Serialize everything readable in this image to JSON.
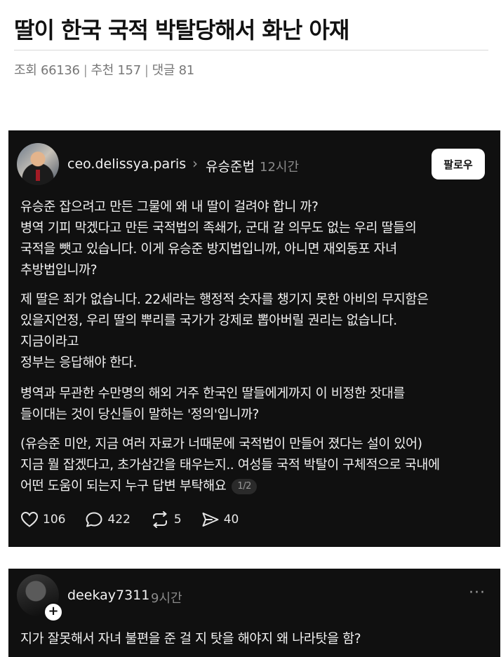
{
  "post": {
    "title": "딸이 한국 국적 박탈당해서 화난 아재",
    "views_label": "조회 66136",
    "recommend_label": "추천 157",
    "comments_label": "댓글 81",
    "separator": "|"
  },
  "thread1": {
    "username": "ceo.delissya.paris",
    "chevron": "›",
    "reply_to": "유승준법",
    "time": "12시간",
    "follow_label": "팔로우",
    "paragraphs": [
      [
        "유승준 잡으려고 만든 그물에 왜 내 딸이 걸려야 합니 까?",
        "병역 기피 막겠다고 만든 국적법의 족쇄가, 군대 갈 의무도 없는 우리 딸들의",
        "국적을 뺏고 있습니다. 이게 유승준 방지법입니까, 아니면 재외동포 자녀",
        "추방법입니까?"
      ],
      [
        "제 딸은 죄가 없습니다. 22세라는 행정적 숫자를 챙기지 못한 아비의 무지함은",
        "있을지언정, 우리 딸의 뿌리를 국가가 강제로 뽑아버릴 권리는 없습니다.",
        "지금이라고",
        "정부는 응답해야 한다."
      ],
      [
        "병역과 무관한 수만명의 해외 거주 한국인 딸들에게까지 이 비정한 잣대를",
        "들이대는 것이 당신들이 말하는 '정의'입니까?"
      ],
      [
        "(유승준 미안, 지금 여러 자료가 너때문에 국적법이 만들어 졌다는 설이 있어)",
        "지금 뭘 잡겠다고, 초가삼간을 태우는지.. 여성들 국적 박탈이 구체적으로 국내에",
        "어떤 도움이  되는지 누구 답변 부탁해요"
      ]
    ],
    "page_indicator": "1/2",
    "actions": {
      "likes": "106",
      "comments": "422",
      "reposts": "5",
      "shares": "40"
    }
  },
  "thread2": {
    "username": "deekay7311",
    "time": "9시간",
    "more": "···",
    "plus": "+",
    "text": "지가 잘못해서 자녀 불편을 준 걸 지 탓을 해야지 왜 나라탓을 함?"
  },
  "icons": {
    "heart": "heart-icon",
    "comment": "comment-icon",
    "repost": "repost-icon",
    "share": "share-icon"
  },
  "colors": {
    "card_background": "#101010",
    "text_light": "#f1f1f1",
    "muted": "#8a8a8a",
    "follow_button": "#ffffff"
  }
}
